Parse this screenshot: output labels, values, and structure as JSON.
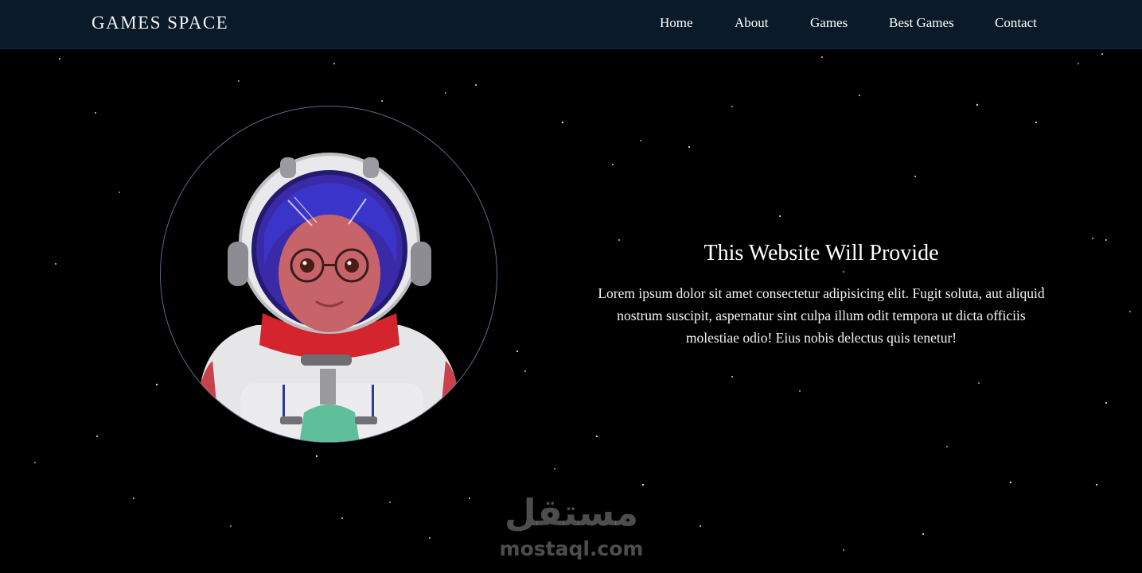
{
  "header": {
    "brand": "GAMES SPACE",
    "nav": [
      {
        "label": "Home"
      },
      {
        "label": "About"
      },
      {
        "label": "Games"
      },
      {
        "label": "Best Games"
      },
      {
        "label": "Contact"
      }
    ]
  },
  "hero": {
    "title": "This Website Will Provide",
    "body": "Lorem ipsum dolor sit amet consectetur adipisicing elit. Fugit soluta, aut aliquid nostrum suscipit, aspernatur sint culpa illum odit tempora ut dicta officiis molestiae odio! Eius nobis delectus quis tenetur!",
    "image_icon": "astronaut-avatar-icon"
  },
  "watermark": {
    "arabic": "مستقل",
    "latin": "mostaql.com"
  },
  "colors": {
    "navbar_bg": "#0a1a28",
    "page_bg": "#000000",
    "ring": "#5a6a8a"
  }
}
